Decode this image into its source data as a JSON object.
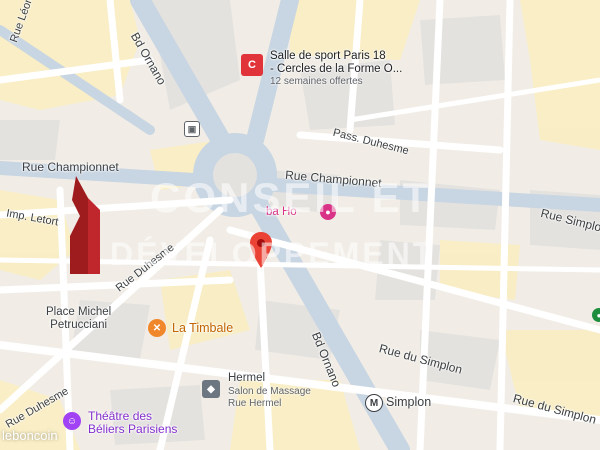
{
  "streets": {
    "rue_leon": "Rue Léon",
    "bd_ornano_top": "Bd Ornano",
    "pass_duhesme": "Pass. Duhesme",
    "rue_championnet": "Rue Championnet",
    "rue_championnet_right": "Rue Championnet",
    "imp_letort": "Imp. Letort",
    "rue_duhesme_mid": "Rue Duhesme",
    "rue_simplon_right": "Rue Simplon",
    "rue_du_simplon": "Rue du Simplon",
    "rue_du_simplon_2": "Rue du Simplon",
    "bd_ornano_bottom": "Bd Ornano",
    "rue_duhesme_bottom": "Rue Duhesme"
  },
  "places": {
    "gym_title": "Salle de sport Paris 18\n- Cercles de la Forme O...",
    "gym_subtitle": "12 semaines offertes",
    "place_michel": "Place Michel\nPetrucciani",
    "la_timbale": "La Timbale",
    "hermel_title": "Hermel",
    "hermel_subtitle": "Salon de Massage\nRue Hermel",
    "theatre": "Théâtre des\nBéliers Parisiens",
    "simplon_station": "Simplon",
    "metro_letter": "M",
    "gym_letter": "C",
    "partial_poi": "ba Ho"
  },
  "watermark": {
    "line1": "CONSEIL ET",
    "line2": "DÉVELOPPEMENT",
    "source": "leboncoin"
  },
  "colors": {
    "road": "#ffffff",
    "major_road": "#d3dde7",
    "block": "#e7e3dc",
    "yellow_block": "#f9eec3",
    "pin": "#ea4335",
    "gym": "#e0343a",
    "food": "#f0882b",
    "theatre": "#a142f4",
    "pink_text": "#d93388"
  },
  "icons": {
    "pin": "red-location-pin-icon",
    "gym": "gym-icon",
    "food": "fork-knife-icon",
    "massage": "spa-icon",
    "theatre": "theatre-masks-icon",
    "metro": "metro-icon",
    "bus": "bus-icon",
    "logo": "agency-logo-icon"
  }
}
